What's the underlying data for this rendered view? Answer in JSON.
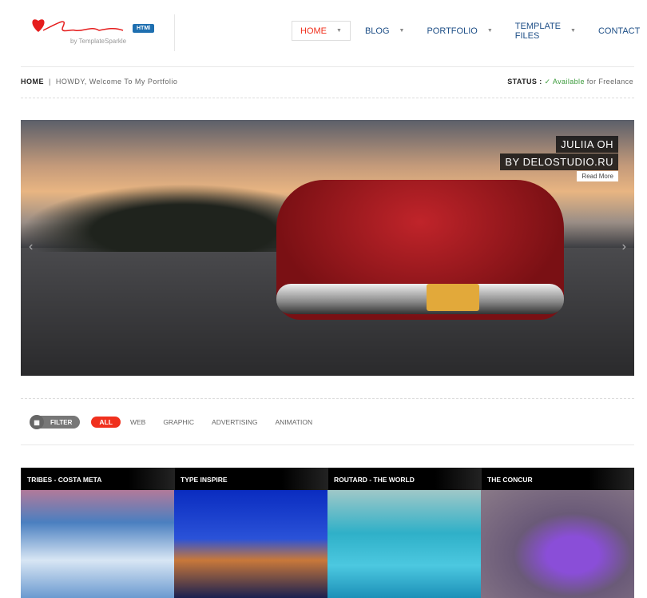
{
  "brand": {
    "logo_text": "Freelancer",
    "by": "by TemplateSparkle",
    "badge": "HTMl"
  },
  "nav": [
    {
      "label": "HOME",
      "active": true,
      "dropdown": true
    },
    {
      "label": "BLOG",
      "dropdown": true
    },
    {
      "label": "PORTFOLIO",
      "dropdown": true
    },
    {
      "label": "TEMPLATE FILES",
      "dropdown": true
    },
    {
      "label": "CONTACT",
      "dropdown": false
    }
  ],
  "breadcrumb": {
    "home": "HOME",
    "sep": "|",
    "text": "HOWDY, Welcome To My Portfolio"
  },
  "status": {
    "label": "STATUS :",
    "check": "✓",
    "available": "Available",
    "rest": "for Freelance",
    "color": "#3a9a3a"
  },
  "slider": {
    "caption1": "JULIIA OH",
    "caption2": "BY DELOSTUDIO.RU",
    "read_more": "Read More",
    "prev": "‹",
    "next": "›"
  },
  "filter": {
    "label": "FILTER",
    "icon": "grid-icon",
    "items": [
      "ALL",
      "WEB",
      "GRAPHIC",
      "ADVERTISING",
      "ANIMATION"
    ],
    "active": "ALL"
  },
  "portfolio": [
    {
      "title": "TRIBES - COSTA META"
    },
    {
      "title": "TYPE INSPIRE"
    },
    {
      "title": "ROUTARD - THE WORLD"
    },
    {
      "title": "THE CONCUR"
    }
  ],
  "colors": {
    "accent": "#f0301d",
    "nav": "#1d4e86"
  }
}
